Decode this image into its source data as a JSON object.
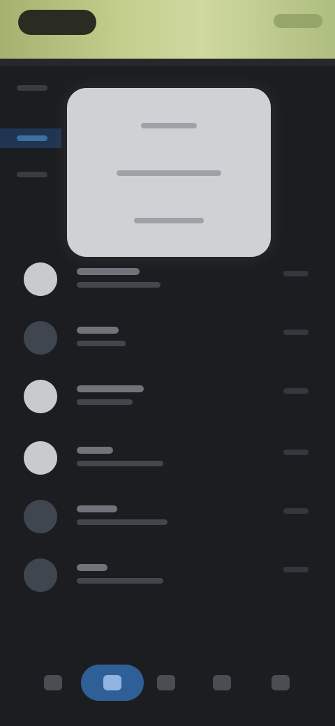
{
  "status_bar": {
    "time": "",
    "battery": ""
  },
  "sidebar": {
    "items": [
      {
        "label": ""
      },
      {
        "label": ""
      },
      {
        "label": ""
      }
    ]
  },
  "context_menu": {
    "items": [
      {
        "label": ""
      },
      {
        "label": ""
      },
      {
        "label": ""
      }
    ]
  },
  "list": {
    "items": [
      {
        "title": "",
        "subtitle": "",
        "meta": "",
        "avatar_tone": "light"
      },
      {
        "title": "",
        "subtitle": "",
        "meta": "",
        "avatar_tone": "dim"
      },
      {
        "title": "",
        "subtitle": "",
        "meta": "",
        "avatar_tone": "light"
      },
      {
        "title": "",
        "subtitle": "",
        "meta": "",
        "avatar_tone": "light"
      },
      {
        "title": "",
        "subtitle": "",
        "meta": "",
        "avatar_tone": "dim"
      },
      {
        "title": "",
        "subtitle": "",
        "meta": "",
        "avatar_tone": "dim"
      }
    ]
  },
  "bottom_nav": {
    "items": [
      {
        "label": "",
        "icon": "back-icon"
      },
      {
        "label": "",
        "icon": "home-icon"
      },
      {
        "label": "",
        "icon": "grid-icon"
      },
      {
        "label": "",
        "icon": "menu-icon"
      },
      {
        "label": "",
        "icon": "profile-icon"
      }
    ]
  },
  "colors": {
    "banner": "#c3cd8b",
    "background": "#1c1d20",
    "accent": "#2f5f97",
    "popup": "#cfd2d4"
  }
}
